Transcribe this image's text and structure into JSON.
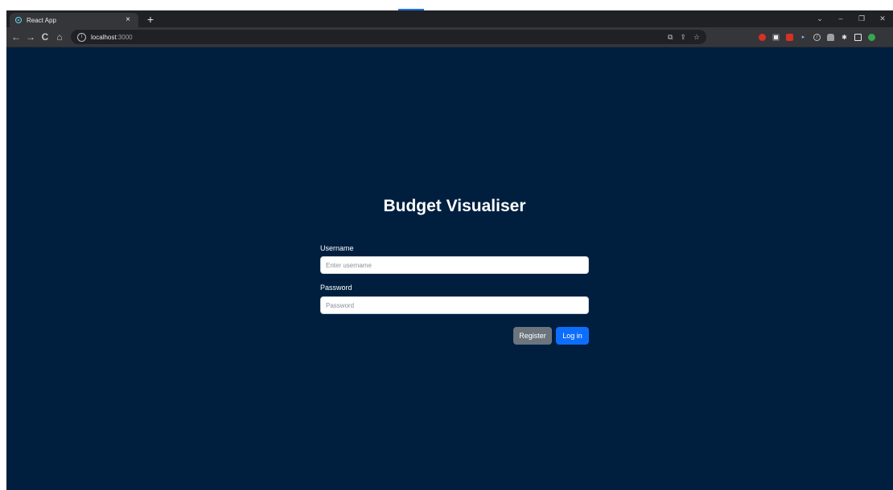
{
  "browser": {
    "tab": {
      "title": "React App",
      "close_glyph": "×",
      "favicon": "react-logo-icon"
    },
    "new_tab_glyph": "+",
    "window_controls": {
      "tabsearch_glyph": "⌄",
      "minimize_glyph": "–",
      "restore_glyph": "❐",
      "close_glyph": "✕"
    },
    "toolbar": {
      "back_glyph": "←",
      "forward_glyph": "→",
      "reload_glyph": "C",
      "home_glyph": "⌂",
      "info_glyph": "i",
      "url_host": "localhost",
      "url_port": ":3000",
      "omnibox_icons": [
        "google-lens-icon",
        "share-icon",
        "bookmark-star-icon"
      ],
      "extension_icons": [
        "extension-red-icon",
        "extension-tile-icon",
        "extension-red-tile-icon",
        "extension-arrow-icon",
        "block-icon",
        "extension-hat-icon",
        "extensions-puzzle-icon",
        "side-panel-icon",
        "profile-avatar-icon"
      ]
    }
  },
  "page": {
    "background_color": "#001f3f",
    "title": "Budget Visualiser",
    "form": {
      "username_label": "Username",
      "username_placeholder": "Enter username",
      "username_value": "",
      "password_label": "Password",
      "password_placeholder": "Password",
      "password_value": "",
      "register_label": "Register",
      "login_label": "Log in"
    },
    "colors": {
      "register_button": "#6c757d",
      "login_button": "#0d6efd"
    }
  }
}
